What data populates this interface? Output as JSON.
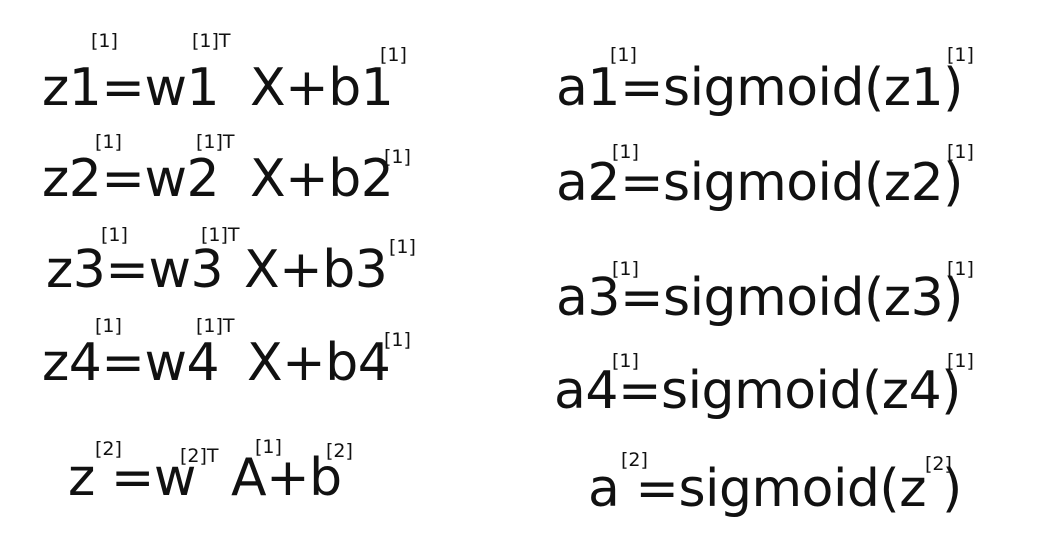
{
  "equations": {
    "left": [
      {
        "a": "z1=w1",
        "b": "X+b1",
        "s1": "[1]",
        "s2": "[1]T",
        "s3": "[1]"
      },
      {
        "a": "z2=w2",
        "b": "X+b2",
        "s1": "[1]",
        "s2": "[1]T",
        "s3": "[1]"
      },
      {
        "a": "z3=w3",
        "b": "X+b3",
        "s1": "[1]",
        "s2": "[1]T",
        "s3": "[1]"
      },
      {
        "a": "z4=w4",
        "b": "X+b4",
        "s1": "[1]",
        "s2": "[1]T",
        "s3": "[1]"
      },
      {
        "a": "z =w",
        "b": "A+b",
        "s1": "[2]",
        "s2": "[2]T",
        "s3": "[1]",
        "s4": "[2]"
      }
    ],
    "right": [
      {
        "text": "a1=sigmoid(z1)",
        "s1": "[1]",
        "s2": "[1]"
      },
      {
        "text": "a2=sigmoid(z2)",
        "s1": "[1]",
        "s2": "[1]"
      },
      {
        "text": "a3=sigmoid(z3)",
        "s1": "[1]",
        "s2": "[1]"
      },
      {
        "text": "a4=sigmoid(z4)",
        "s1": "[1]",
        "s2": "[1]"
      },
      {
        "text": "a =sigmoid(z )",
        "s1": "[2]",
        "s2": "[2]"
      }
    ]
  }
}
